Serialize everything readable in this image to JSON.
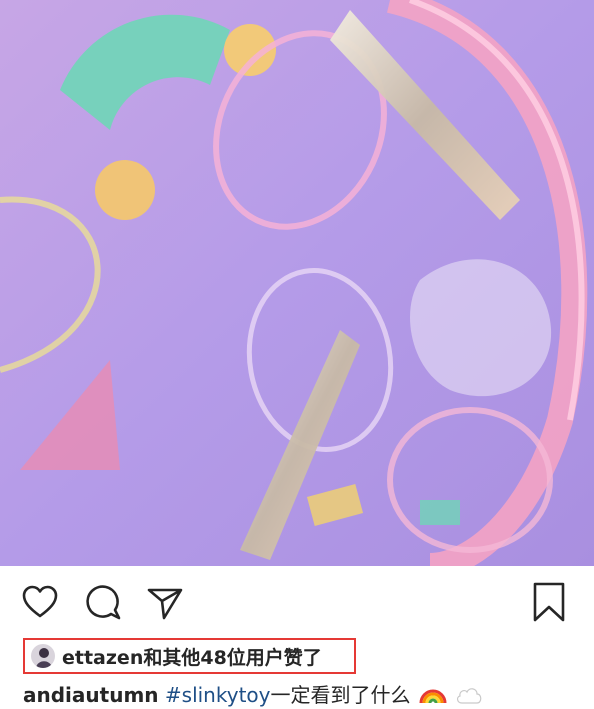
{
  "post": {
    "liked_by_user": "ettazen",
    "likes_summary": "和其他48位用户赞了",
    "caption_user": "andiautumn",
    "caption_hashtag": "#slinkytoy",
    "caption_text": "一定看到了什么"
  },
  "icons": {
    "like": "heart-icon",
    "comment": "comment-bubble-icon",
    "share": "paper-plane-icon",
    "save": "bookmark-icon",
    "emoji_1": "rainbow-emoji",
    "emoji_2": "cloud-emoji"
  },
  "colors": {
    "highlight_border": "#e53935",
    "hashtag": "#1f4f86",
    "text": "#262626"
  }
}
